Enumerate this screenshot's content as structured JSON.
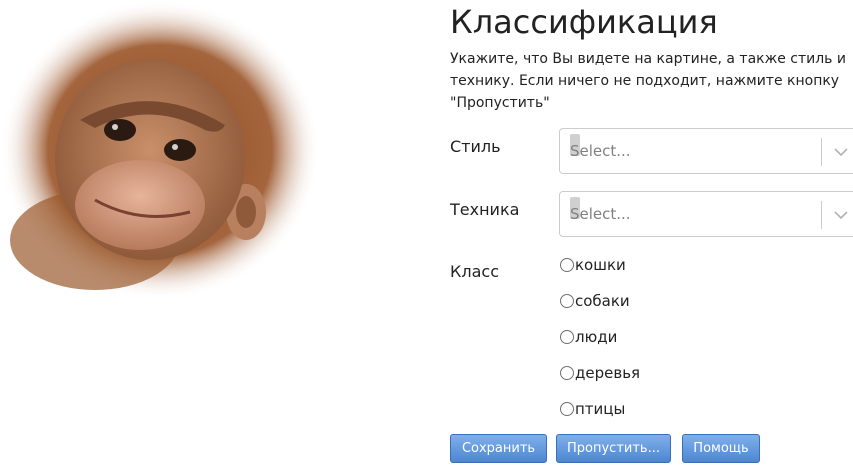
{
  "header": {
    "title": "Классификация",
    "instructions": "Укажите, что Вы видете на картине, а также стиль и технику. Если ничего не подходит, нажмите кнопку \"Пропустить\""
  },
  "image": {
    "subject": "orangutan-photo"
  },
  "form": {
    "style": {
      "label": "Стиль",
      "placeholder": "Select..."
    },
    "technique": {
      "label": "Техника",
      "placeholder": "Select..."
    },
    "class": {
      "label": "Класс",
      "options": [
        "кошки",
        "собаки",
        "люди",
        "деревья",
        "птицы"
      ]
    }
  },
  "buttons": {
    "save": "Сохранить",
    "skip": "Пропустить...",
    "help": "Помощь"
  },
  "colors": {
    "button": "#5a8fd6",
    "select_border": "#cccccc"
  }
}
